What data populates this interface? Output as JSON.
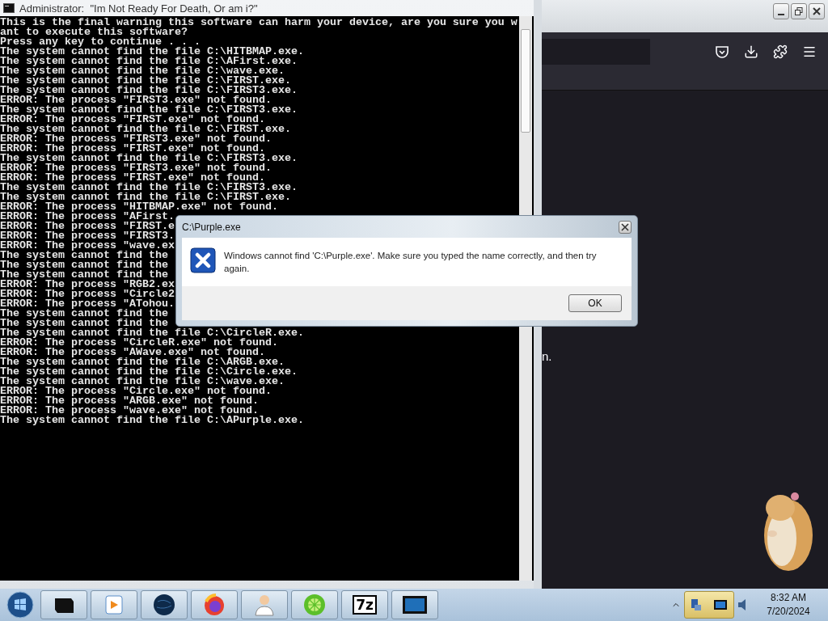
{
  "console": {
    "title": "Administrator:  \"Im Not Ready For Death, Or am i?\"",
    "lines": [
      "This is the final warning this software can harm your device, are you sure you w",
      "ant to execute this software?",
      "Press any key to continue . . .",
      "The system cannot find the file C:\\HITBMAP.exe.",
      "The system cannot find the file C:\\AFirst.exe.",
      "The system cannot find the file C:\\wave.exe.",
      "The system cannot find the file C:\\FIRST.exe.",
      "The system cannot find the file C:\\FIRST3.exe.",
      "ERROR: The process \"FIRST3.exe\" not found.",
      "The system cannot find the file C:\\FIRST3.exe.",
      "ERROR: The process \"FIRST.exe\" not found.",
      "The system cannot find the file C:\\FIRST.exe.",
      "ERROR: The process \"FIRST3.exe\" not found.",
      "ERROR: The process \"FIRST.exe\" not found.",
      "The system cannot find the file C:\\FIRST3.exe.",
      "ERROR: The process \"FIRST3.exe\" not found.",
      "ERROR: The process \"FIRST.exe\" not found.",
      "The system cannot find the file C:\\FIRST3.exe.",
      "The system cannot find the file C:\\FIRST.exe.",
      "ERROR: The process \"HITBMAP.exe\" not found.",
      "ERROR: The process \"AFirst.",
      "ERROR: The process \"FIRST.e",
      "ERROR: The process \"FIRST3.",
      "ERROR: The process \"wave.ex",
      "The system cannot find the",
      "The system cannot find the",
      "The system cannot find the",
      "ERROR: The process \"RGB2.ex",
      "ERROR: The process \"Circle2",
      "ERROR: The process \"ATohou.",
      "The system cannot find the",
      "The system cannot find the",
      "The system cannot find the file C:\\CircleR.exe.",
      "ERROR: The process \"CircleR.exe\" not found.",
      "ERROR: The process \"AWave.exe\" not found.",
      "The system cannot find the file C:\\ARGB.exe.",
      "The system cannot find the file C:\\Circle.exe.",
      "The system cannot find the file C:\\wave.exe.",
      "ERROR: The process \"Circle.exe\" not found.",
      "ERROR: The process \"ARGB.exe\" not found.",
      "ERROR: The process \"wave.exe\" not found.",
      "The system cannot find the file C:\\APurple.exe."
    ]
  },
  "browser": {
    "fragments": [
      "n."
    ]
  },
  "dialog": {
    "title": "C:\\Purple.exe",
    "message": "Windows cannot find 'C:\\Purple.exe'. Make sure you typed the name correctly, and then try again.",
    "button": "OK"
  },
  "taskbar": {
    "archive_label": "7z",
    "time": "8:32 AM",
    "date": "7/20/2024"
  }
}
